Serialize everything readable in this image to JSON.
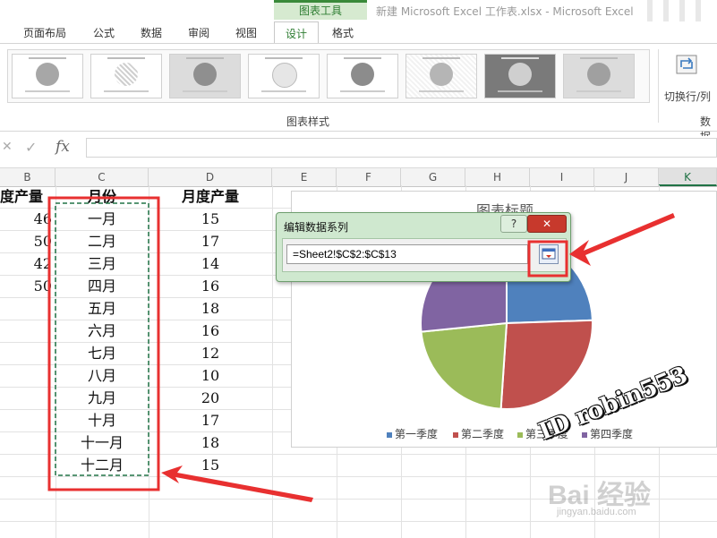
{
  "window": {
    "context_group": "图表工具",
    "title": "新建 Microsoft Excel 工作表.xlsx - Microsoft Excel"
  },
  "tabs": [
    {
      "label": "页面布局"
    },
    {
      "label": "公式"
    },
    {
      "label": "数据"
    },
    {
      "label": "审阅"
    },
    {
      "label": "视图"
    },
    {
      "label": "设计",
      "active": true
    },
    {
      "label": "格式"
    }
  ],
  "ribbon": {
    "chart_styles_group": "图表样式",
    "switch_row_col": "切换行/列",
    "data_group": "数据",
    "switch_icon": "switch-row-column-icon"
  },
  "formula_bar": {
    "cancel_icon": "✕",
    "enter_icon": "✓",
    "fx_label": "fx",
    "value": ""
  },
  "columns": [
    "B",
    "C",
    "D",
    "E",
    "F",
    "G",
    "H",
    "I",
    "J",
    "K"
  ],
  "selected_column": "K",
  "sheet": {
    "headers": {
      "B": "度产量",
      "C": "月份",
      "D": "月度产量"
    },
    "col_b": [
      "46",
      "50",
      "42",
      "50"
    ],
    "months": [
      "一月",
      "二月",
      "三月",
      "四月",
      "五月",
      "六月",
      "七月",
      "八月",
      "九月",
      "十月",
      "十一月",
      "十二月"
    ],
    "monthly_output": [
      "15",
      "17",
      "14",
      "16",
      "18",
      "16",
      "12",
      "10",
      "20",
      "17",
      "18",
      "15"
    ]
  },
  "chart_data": {
    "type": "pie",
    "title": "图表标题",
    "categories": [
      "第一季度",
      "第二季度",
      "第三季度",
      "第四季度"
    ],
    "values": [
      46,
      50,
      42,
      50
    ],
    "colors": [
      "#4f81bd",
      "#c0504d",
      "#9bbb59",
      "#8064a2"
    ],
    "legend_position": "bottom"
  },
  "dialog": {
    "title": "编辑数据系列",
    "help": "?",
    "close": "✕",
    "range_value": "=Sheet2!$C$2:$C$13",
    "collapse_icon": "range-collapse-icon"
  },
  "annotations": {
    "highlight_color": "#e83030",
    "watermark": "ID robin553",
    "logo_text": "Bai 经验",
    "logo_url": "jingyan.baidu.com"
  }
}
